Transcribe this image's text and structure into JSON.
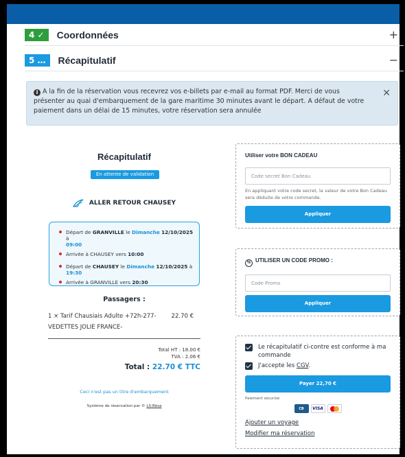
{
  "colors": {
    "brand_blue": "#0a5ea8",
    "accent_blue": "#1a9ae0",
    "step_green": "#2e9e3c",
    "step_blue": "#1a9ae0",
    "alert_bg": "#dbe8f1"
  },
  "steps": [
    {
      "badge": "4 ✓",
      "title": "Coordonnées",
      "toggle": "+"
    },
    {
      "badge": "5 …",
      "title": "Récapitulatif",
      "toggle": "−"
    }
  ],
  "alert": {
    "icon": "info-icon",
    "text": "A la fin de la réservation vous recevrez vos e-billets par e-mail au format PDF. Merci de vous présenter au quai d'embarquement de la gare maritime 30 minutes avant le départ. A défaut de votre paiement dans un délai de 15 minutes, votre réservation sera annulée",
    "close": "✕"
  },
  "summary": {
    "title": "Récapitulatif",
    "status": "En attente de validation",
    "trip_title": "ALLER RETOUR CHAUSEY",
    "schedule": [
      {
        "pre": "Départ de ",
        "place": "GRANVILLE",
        "mid": " le ",
        "day": "Dimanche",
        "date": "12/10/2025",
        "suffix": " à",
        "time": "09:00"
      },
      {
        "pre": "Arrivée à CHAUSEY vers ",
        "time": "10:00"
      },
      {
        "pre": "Départ de ",
        "place": "CHAUSEY",
        "mid": " le ",
        "day": "Dimanche",
        "date": "12/10/2025",
        "suffix": " à",
        "time": "19:30"
      },
      {
        "pre": "Arrivée à GRANVILLE vers ",
        "time": "20:30"
      }
    ],
    "passengers_title": "Passagers :",
    "passenger_desc": "1 × Tarif Chausiais Adulte +72h-277-VEDETTES JOLIE FRANCE-",
    "passenger_price": "22.70 €",
    "total_ht": "Total HT : 18.00 €",
    "tva": "TVA :  2.06 €",
    "total_label": "Total : ",
    "total_value": "22.70 € TTC",
    "not_ticket": "Ceci n'est pas un titre d'embarquement",
    "powered_by": "Système de réservation par © ",
    "powered_link": "LS-Résa"
  },
  "gift": {
    "title": "Utiliser votre BON CADEAU",
    "placeholder": "Code secret Bon Cadeau",
    "hint": "En appliquant votre code secret, la valeur de votre Bon Cadeau sera déduite de votre commande.",
    "button": "Appliquer"
  },
  "promo": {
    "icon_text": "%",
    "title": "UTILISER UN CODE PROMO :",
    "placeholder": "Code Promo",
    "button": "Appliquer"
  },
  "payment": {
    "check_summary": "Le récapitulatif ci-contre est conforme à ma commande",
    "check_cgv_pre": "J'accepte les ",
    "check_cgv_link": "CGV",
    "check_cgv_post": ".",
    "pay_button": "Payer 22,70 €",
    "secure": "Paiement sécurisé",
    "cards": [
      "CB",
      "VISA",
      "mastercard"
    ],
    "add_trip": "Ajouter un voyage",
    "modify": "Modifier ma réservation"
  }
}
